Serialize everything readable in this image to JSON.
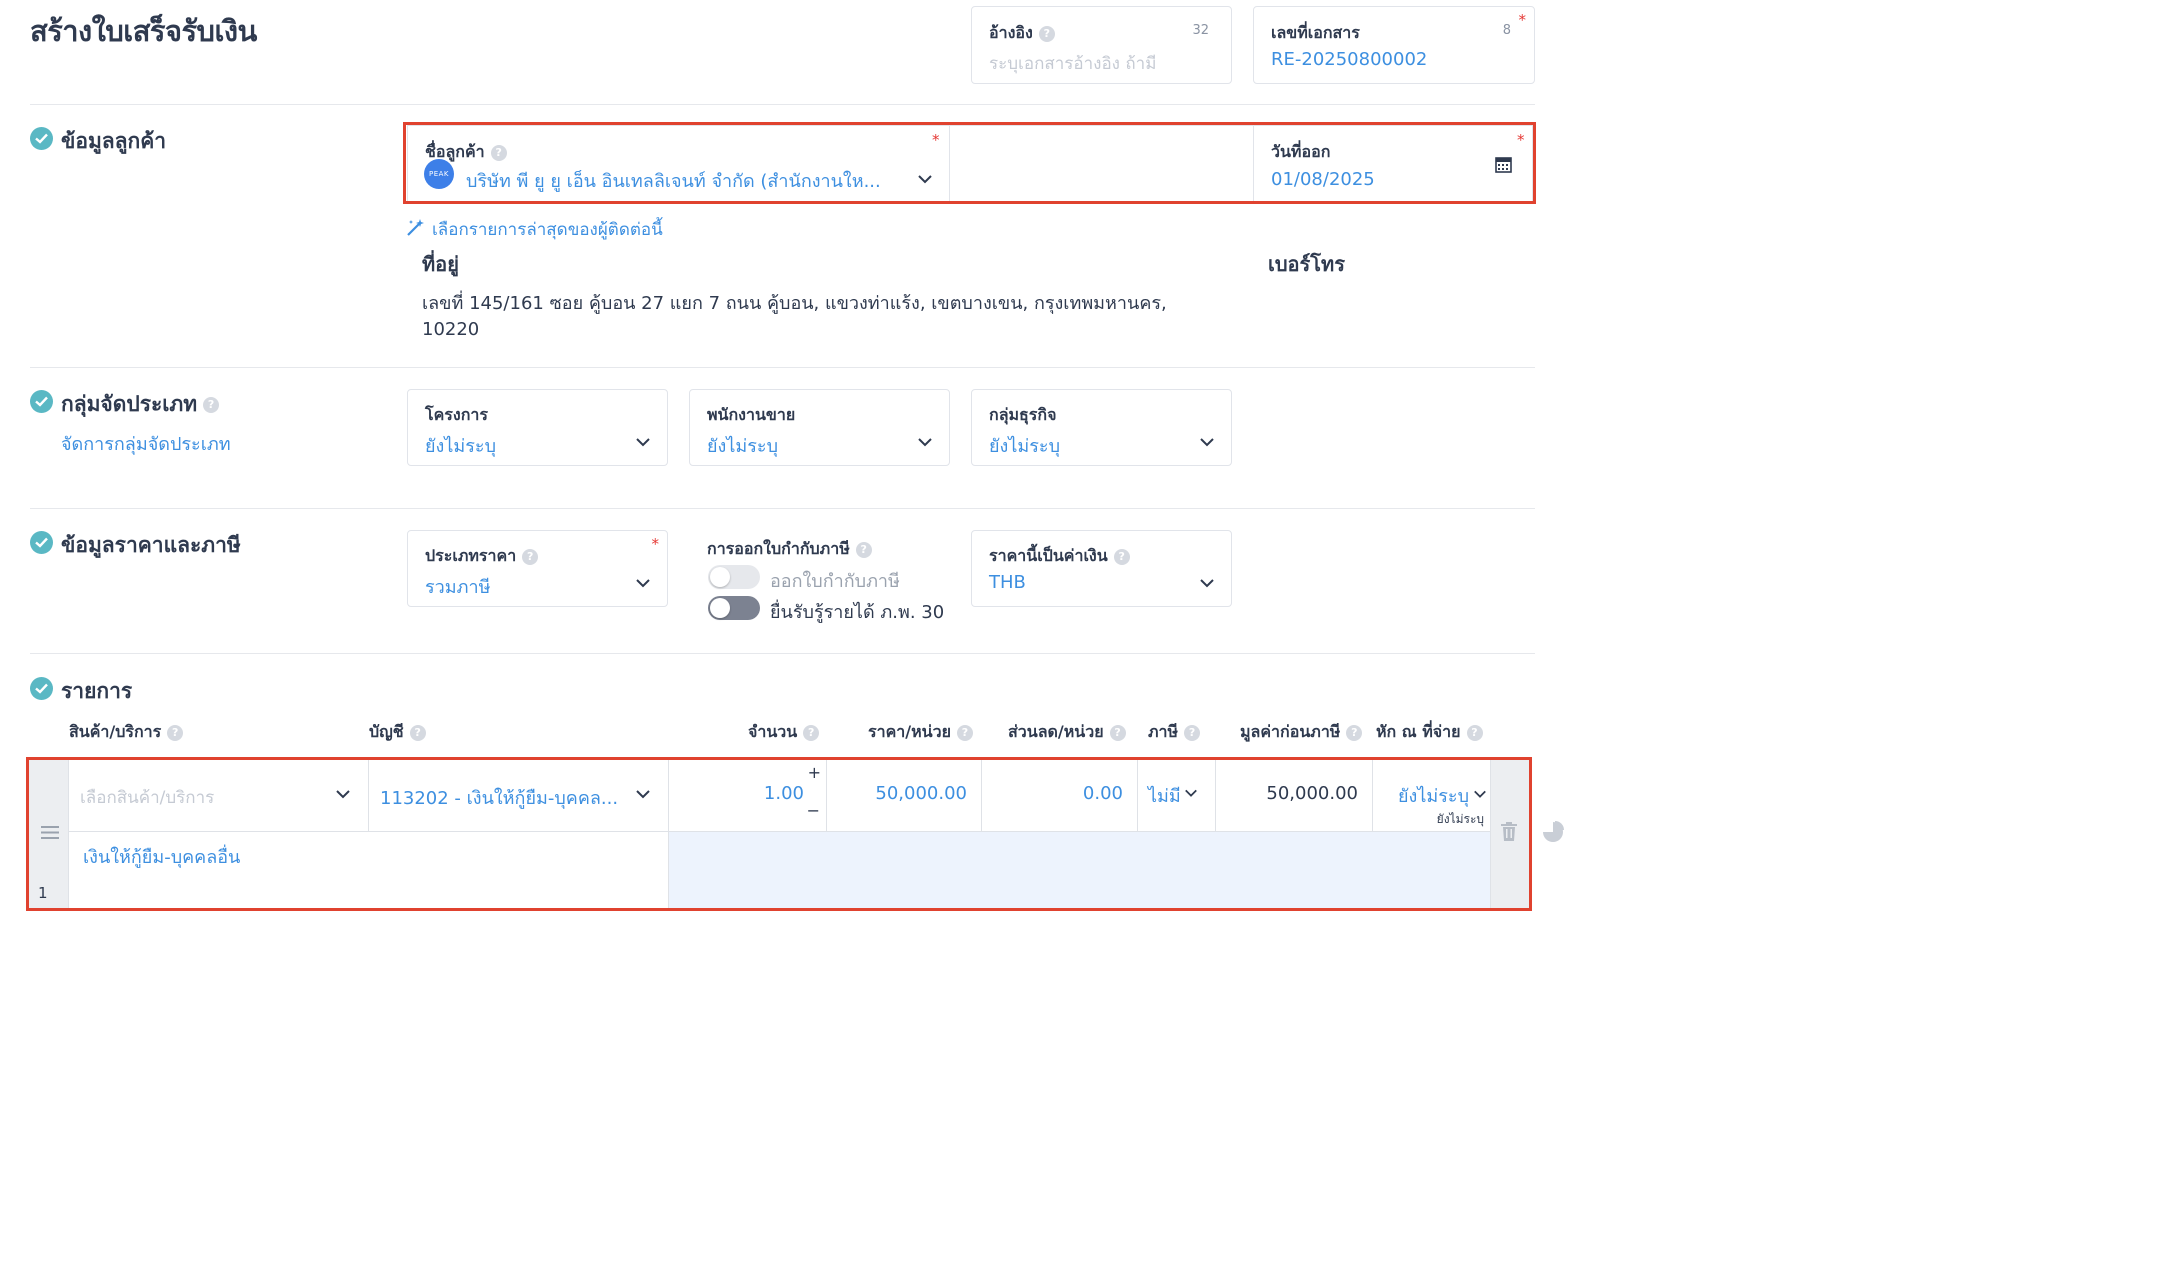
{
  "page": {
    "title": "สร้างใบเสร็จรับเงิน"
  },
  "reference": {
    "label": "อ้างอิง",
    "count": "32",
    "placeholder": "ระบุเอกสารอ้างอิง ถ้ามี"
  },
  "doc_number": {
    "label": "เลขที่เอกสาร",
    "count": "8",
    "value": "RE-20250800002",
    "required": "*"
  },
  "customer_section": {
    "heading": "ข้อมูลลูกค้า",
    "customer_label": "ชื่อลูกค้า",
    "customer_value": "บริษัท พี ยู ยู เอ็น อินเทลลิเจนท์ จำกัด (สำนักงานให...",
    "customer_logo": "PEAK",
    "required": "*",
    "issue_date_label": "วันที่ออก",
    "issue_date_value": "01/08/2025",
    "recent_link": "เลือกรายการล่าสุดของผู้ติดต่อนี้",
    "address_label": "ที่อยู่",
    "address_line1": "เลขที่ 145/161 ซอย คู้บอน 27 แยก 7 ถนน คู้บอน, แขวงท่าแร้ง, เขตบางเขน, กรุงเทพมหานคร,",
    "address_line2": "10220",
    "phone_label": "เบอร์โทร"
  },
  "classification_section": {
    "heading": "กลุ่มจัดประเภท",
    "manage_link": "จัดการกลุ่มจัดประเภท",
    "project_label": "โครงการ",
    "project_value": "ยังไม่ระบุ",
    "salesperson_label": "พนักงานขาย",
    "salesperson_value": "ยังไม่ระบุ",
    "business_group_label": "กลุ่มธุรกิจ",
    "business_group_value": "ยังไม่ระบุ"
  },
  "pricing_section": {
    "heading": "ข้อมูลราคาและภาษี",
    "price_type_label": "ประเภทราคา",
    "price_type_value": "รวมภาษี",
    "required": "*",
    "tax_invoice_label": "การออกใบกำกับภาษี",
    "toggle_issue_tax_invoice": "ออกใบกำกับภาษี",
    "toggle_issue_tax_invoice_on": false,
    "toggle_pp30": "ยื่นรับรู้รายได้ ภ.พ. 30",
    "toggle_pp30_on": true,
    "currency_label": "ราคานี้เป็นค่าเงิน",
    "currency_value": "THB"
  },
  "items_section": {
    "heading": "รายการ",
    "columns": {
      "product": "สินค้า/บริการ",
      "account": "บัญชี",
      "quantity": "จำนวน",
      "unit_price": "ราคา/หน่วย",
      "discount": "ส่วนลด/หน่วย",
      "tax": "ภาษี",
      "pre_tax": "มูลค่าก่อนภาษี",
      "withholding": "หัก ณ ที่จ่าย"
    },
    "rows": [
      {
        "index": "1",
        "product_placeholder": "เลือกสินค้า/บริการ",
        "account": "113202 - เงินให้กู้ยืม-บุคคล...",
        "quantity": "1.00",
        "unit_price": "50,000.00",
        "discount": "0.00",
        "tax": "ไม่มี",
        "pre_tax": "50,000.00",
        "withholding": "ยังไม่ระบุ",
        "withholding_sub": "ยังไม่ระบุ",
        "description": "เงินให้กู้ยืม-บุคคลอื่น"
      }
    ]
  },
  "colors": {
    "accent": "#3d8fe0",
    "check": "#5ab8c4",
    "highlight": "#e0422f",
    "row_bg": "#edf3fd"
  }
}
